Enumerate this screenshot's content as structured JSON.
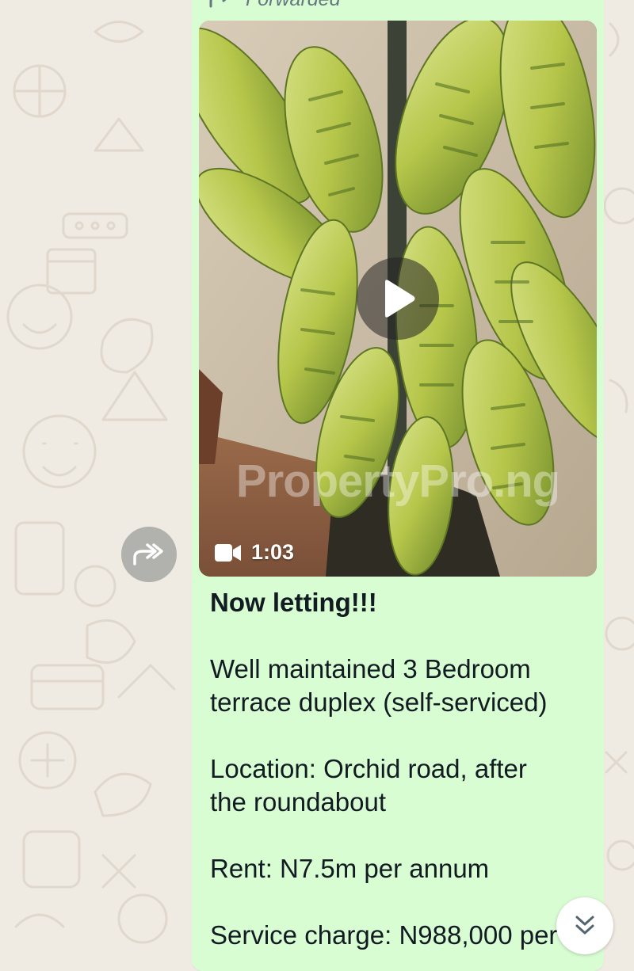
{
  "message": {
    "forwarded_label": "Forwarded",
    "video": {
      "duration": "1:03",
      "watermark": "PropertyPro.ng"
    },
    "caption": {
      "heading": "Now letting!!!",
      "description_line1": "Well maintained 3 Bedroom",
      "description_line2": "terrace duplex (self-serviced)",
      "location_line1": "Location: Orchid road, after",
      "location_line2": "the roundabout",
      "rent": "Rent: N7.5m per annum",
      "service_charge": "Service charge: N988,000 per"
    }
  },
  "icons": {
    "forward": "forward-icon",
    "play": "play-icon",
    "video_camera": "video-camera-icon",
    "share": "share-forward-icon",
    "scroll_down": "double-chevron-down-icon"
  },
  "colors": {
    "chat_background": "#efeae2",
    "bubble_background": "#d9fdd3",
    "text_primary": "#111b21",
    "text_secondary": "#667781"
  }
}
